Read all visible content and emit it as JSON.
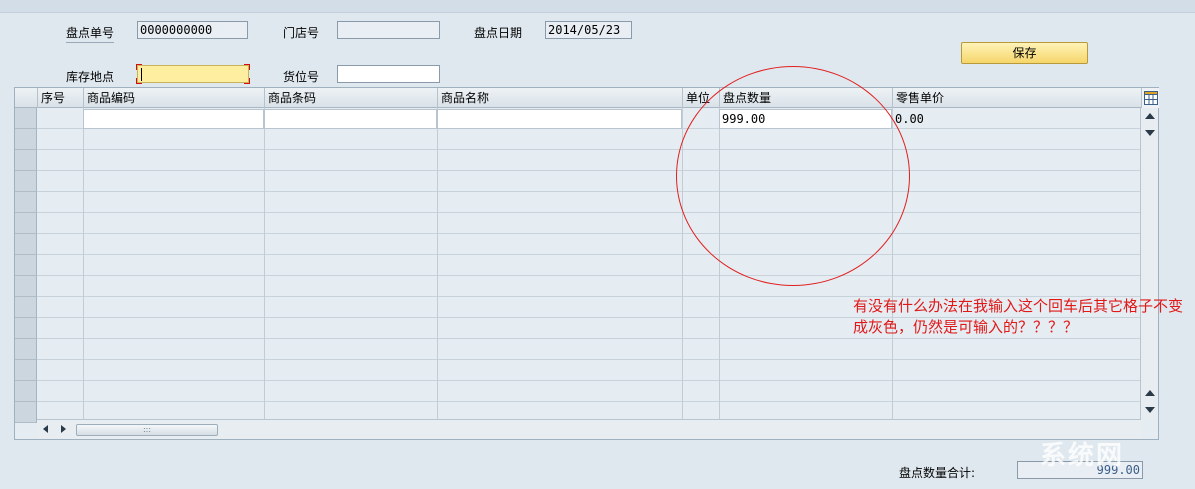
{
  "header": {
    "doc_no_label": "盘点单号",
    "doc_no_value": "0000000000",
    "store_label": "门店号",
    "store_value": "",
    "date_label": "盘点日期",
    "date_value": "2014/05/23",
    "location_label": "库存地点",
    "location_value": "",
    "bin_label": "货位号",
    "bin_value": "",
    "save_label": "保存"
  },
  "table": {
    "columns": [
      "序号",
      "商品编码",
      "商品条码",
      "商品名称",
      "单位",
      "盘点数量",
      "零售单价"
    ],
    "rows": [
      {
        "seq": "",
        "code": "",
        "barcode": "",
        "name": "",
        "unit": "",
        "qty": "999.00",
        "price": "0.00"
      }
    ],
    "layout_icon": "table-settings-icon"
  },
  "footer": {
    "total_label": "盘点数量合计:",
    "total_value": "999.00"
  },
  "annotation": {
    "text": "有没有什么办法在我输入这个回车后其它格子不变成灰色，仍然是可输入的？？？？"
  },
  "watermark": "系统网",
  "colors": {
    "required_marker": "#d01010",
    "annotation": "#e01818",
    "input_highlight": "#fdeea0"
  }
}
